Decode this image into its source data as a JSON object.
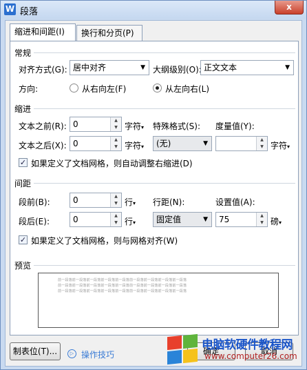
{
  "window": {
    "title": "段落",
    "app_icon": "W",
    "close": "x"
  },
  "tabs": [
    "缩进和间距(I)",
    "换行和分页(P)"
  ],
  "general": {
    "heading": "常规",
    "align_label": "对齐方式(G):",
    "align_value": "居中对齐",
    "outline_label": "大纲级别(O):",
    "outline_value": "正文文本",
    "direction_label": "方向:",
    "rtl_label": "从右向左(F)",
    "ltr_label": "从左向右(L)"
  },
  "indent": {
    "heading": "缩进",
    "before_label": "文本之前(R):",
    "before_value": "0",
    "after_label": "文本之后(X):",
    "after_value": "0",
    "unit_char": "字符",
    "special_label": "特殊格式(S):",
    "special_value": "(无)",
    "measure_label": "度量值(Y):",
    "measure_value": "",
    "measure_unit": "字符",
    "grid_checkbox": "如果定义了文档网格，则自动调整右缩进(D)"
  },
  "spacing": {
    "heading": "间距",
    "before_label": "段前(B):",
    "before_value": "0",
    "after_label": "段后(E):",
    "after_value": "0",
    "unit_line": "行",
    "line_spacing_label": "行距(N):",
    "line_spacing_value": "固定值",
    "setting_label": "设置值(A):",
    "setting_value": "75",
    "setting_unit": "磅",
    "grid_checkbox": "如果定义了文档网格，则与网格对齐(W)"
  },
  "preview": {
    "heading": "预览",
    "sample": "前一段落前一段落前一段落前一段落前一段落前一段落前一段落前一段落前一段落"
  },
  "footer": {
    "tabs_button": "制表位(T)...",
    "tips_label": "操作技巧",
    "ok_button": "确定",
    "cancel_button": "取消"
  },
  "watermark": {
    "title": "电脑软硬件教程网",
    "url": "www.computer26.com"
  }
}
